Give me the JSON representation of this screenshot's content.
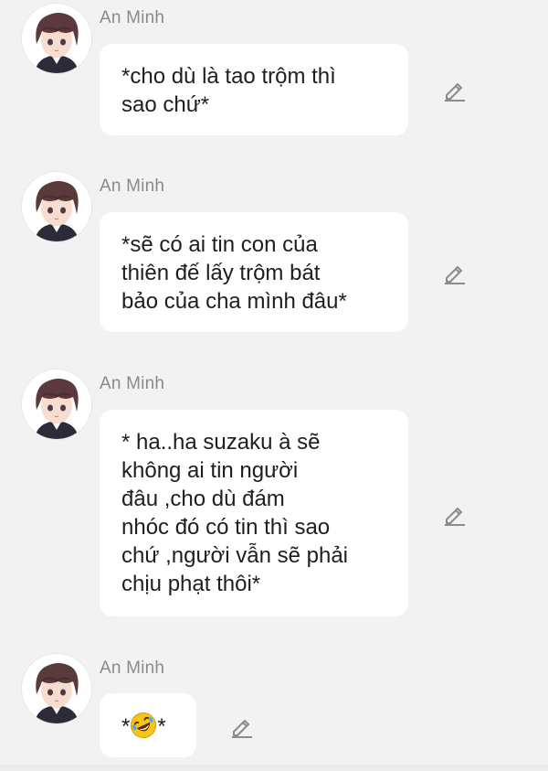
{
  "messages": [
    {
      "sender": "An Minh",
      "lines": [
        "*cho dù là tao trộm thì",
        "sao chứ*"
      ]
    },
    {
      "sender": "An Minh",
      "lines": [
        "*sẽ có ai tin con của",
        "thiên đế lấy trộm bát",
        "bảo của cha mình đâu*"
      ]
    },
    {
      "sender": "An Minh",
      "lines": [
        "* ha..ha suzaku à sẽ",
        "không ai tin người",
        "đâu ,cho dù đám",
        "nhóc đó có tin thì sao",
        "chứ ,người vẫn sẽ phải",
        "chịu phạt thôi*"
      ]
    },
    {
      "sender": "An Minh",
      "prefix": "*",
      "emoji": "rolling-on-floor-laughing-emoji",
      "suffix": "*"
    }
  ],
  "icons": {
    "avatar": "anime-boy-avatar",
    "edit": "pencil-edit-icon"
  },
  "colors": {
    "background": "#f2f2f2",
    "bubble": "#ffffff",
    "text": "#1e1e1e",
    "sender": "#8a8a8a",
    "icon": "#8c8c8c"
  }
}
